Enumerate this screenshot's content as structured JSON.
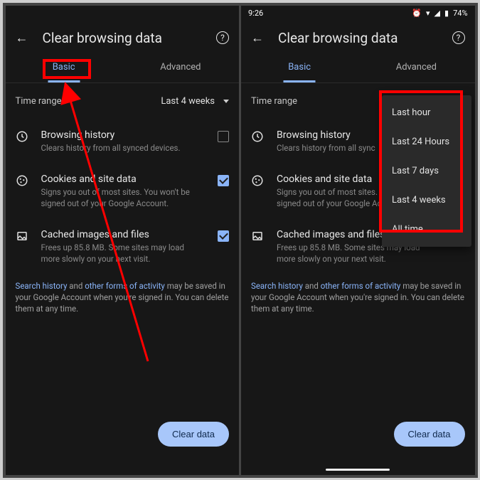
{
  "header": {
    "title": "Clear browsing data"
  },
  "tabs": {
    "basic": "Basic",
    "advanced": "Advanced"
  },
  "time": {
    "label": "Time range",
    "value": "Last 4 weeks"
  },
  "items": [
    {
      "title": "Browsing history",
      "sub": "Clears history from all synced devices.",
      "checked": false
    },
    {
      "title": "Cookies and site data",
      "sub": "Signs you out of most sites. You won't be signed out of your Google Account.",
      "checked": true
    },
    {
      "title": "Cached images and files",
      "sub": "Frees up 85.8 MB. Some sites may load more slowly on your next visit.",
      "checked": true
    }
  ],
  "footnote": {
    "p1": "Search history",
    "p2": " and ",
    "p3": "other forms of activity",
    "p4": " may be saved in your Google Account when you're signed in. You can delete them at any time."
  },
  "button": "Clear data",
  "dropdown": [
    "Last hour",
    "Last 24 Hours",
    "Last 7 days",
    "Last 4 weeks",
    "All time"
  ],
  "status": {
    "time": "9:26",
    "battery": "74%"
  },
  "right_item1_sub": "Clears history from all sync"
}
